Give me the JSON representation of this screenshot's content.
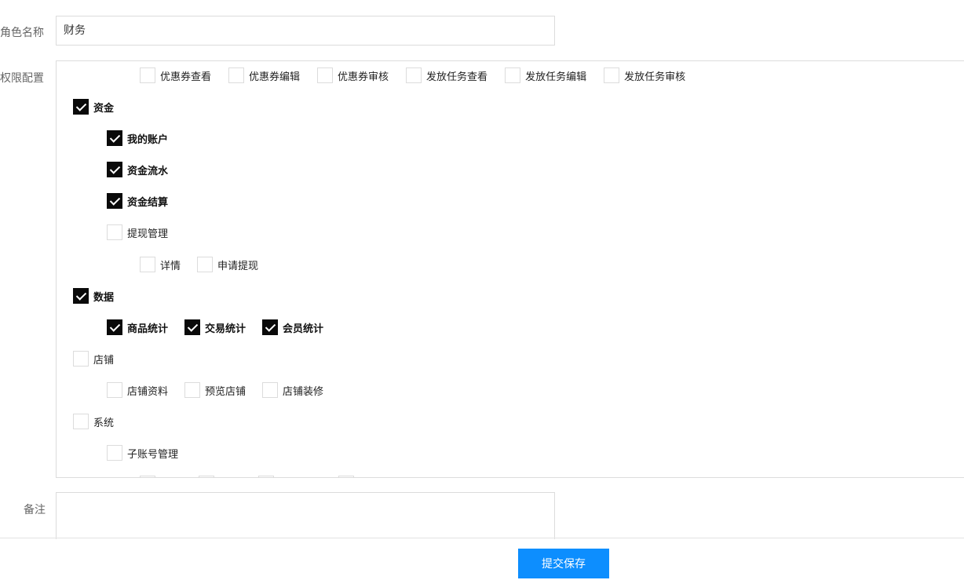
{
  "form": {
    "role_label": "角色名称",
    "role_value": "财务",
    "perm_label": "权限配置",
    "remark_label": "备注",
    "submit_label": "提交保存"
  },
  "permissions": {
    "coupon_row": [
      {
        "label": "优惠券查看",
        "checked": false
      },
      {
        "label": "优惠券编辑",
        "checked": false
      },
      {
        "label": "优惠券审核",
        "checked": false
      },
      {
        "label": "发放任务查看",
        "checked": false
      },
      {
        "label": "发放任务编辑",
        "checked": false
      },
      {
        "label": "发放任务审核",
        "checked": false
      }
    ],
    "funds": {
      "label": "资金",
      "checked": true
    },
    "my_account": {
      "label": "我的账户",
      "checked": true
    },
    "fund_flow": {
      "label": "资金流水",
      "checked": true
    },
    "fund_settle": {
      "label": "资金结算",
      "checked": true
    },
    "withdraw_manage": {
      "label": "提现管理",
      "checked": false
    },
    "withdraw_children": [
      {
        "label": "详情",
        "checked": false
      },
      {
        "label": "申请提现",
        "checked": false
      }
    ],
    "data": {
      "label": "数据",
      "checked": true
    },
    "data_children": [
      {
        "label": "商品统计",
        "checked": true
      },
      {
        "label": "交易统计",
        "checked": true
      },
      {
        "label": "会员统计",
        "checked": true
      }
    ],
    "shop": {
      "label": "店铺",
      "checked": false
    },
    "shop_children": [
      {
        "label": "店铺资料",
        "checked": false
      },
      {
        "label": "预览店铺",
        "checked": false
      },
      {
        "label": "店铺装修",
        "checked": false
      }
    ],
    "system": {
      "label": "系统",
      "checked": false
    },
    "sub_account": {
      "label": "子账号管理",
      "checked": false
    }
  }
}
